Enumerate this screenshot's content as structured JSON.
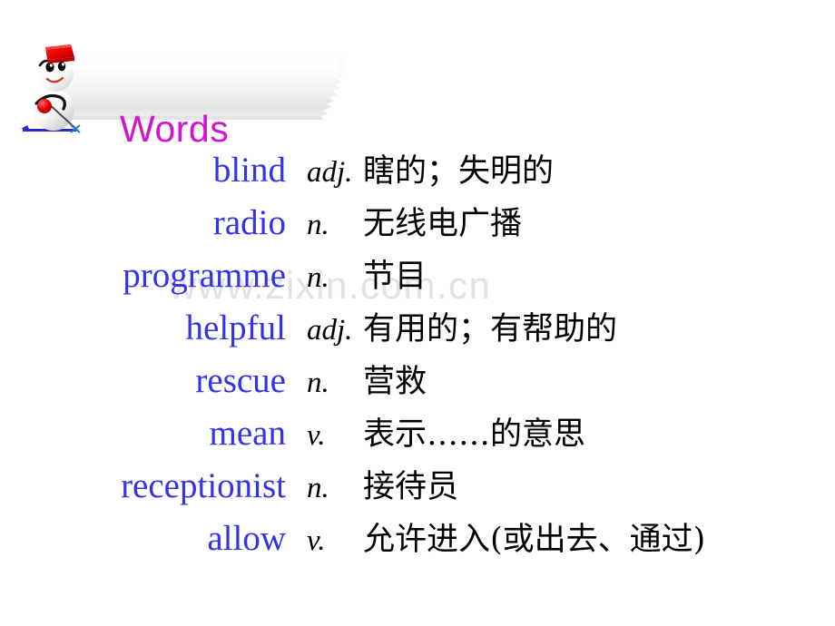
{
  "slide": {
    "title": "Words",
    "title_color": "#d213d2",
    "word_color": "#3333e8",
    "watermark": "www.zixin.com.cn",
    "watermark_color": "#e2e2e2",
    "mascot": "snowman-skier-icon"
  },
  "vocabulary": {
    "columns": [
      "word",
      "part_of_speech",
      "definition"
    ],
    "rows": [
      {
        "word": "blind",
        "pos": "adj.",
        "definition": "瞎的；失明的"
      },
      {
        "word": "radio",
        "pos": "n.",
        "definition": "无线电广播"
      },
      {
        "word": "programme",
        "pos": "n.",
        "definition": "节目"
      },
      {
        "word": "helpful",
        "pos": "adj.",
        "definition": "有用的；有帮助的"
      },
      {
        "word": "rescue",
        "pos": "n.",
        "definition": "营救"
      },
      {
        "word": "mean",
        "pos": "v.",
        "definition": "表示……的意思"
      },
      {
        "word": "receptionist",
        "pos": "n.",
        "definition": "接待员"
      },
      {
        "word": "allow",
        "pos": "v.",
        "definition": "允许进入(或出去、通过)"
      }
    ]
  }
}
